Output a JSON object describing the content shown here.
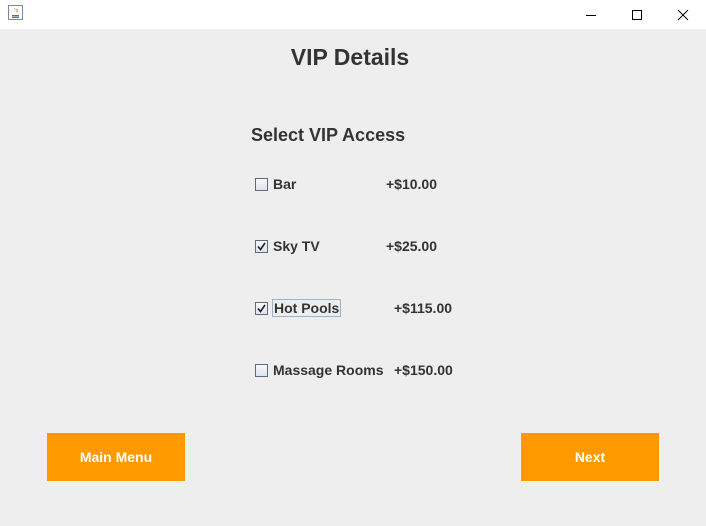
{
  "window": {
    "icon": "java-app-icon",
    "controls": [
      "minimize-icon",
      "maximize-icon",
      "close-icon"
    ]
  },
  "page": {
    "title": "VIP Details",
    "subtitle": "Select VIP Access"
  },
  "options": [
    {
      "label": "Bar",
      "price": "+$10.00",
      "checked": false
    },
    {
      "label": "Sky TV",
      "price": "+$25.00",
      "checked": true
    },
    {
      "label": "Hot Pools",
      "price": "+$115.00",
      "checked": true,
      "focused": true
    },
    {
      "label": "Massage Rooms",
      "price": "+$150.00",
      "checked": false
    }
  ],
  "buttons": {
    "main_menu": "Main Menu",
    "next": "Next"
  },
  "colors": {
    "button_bg": "#ff9900",
    "button_text": "#ffffff",
    "background": "#eeeeee",
    "text": "#333333"
  }
}
